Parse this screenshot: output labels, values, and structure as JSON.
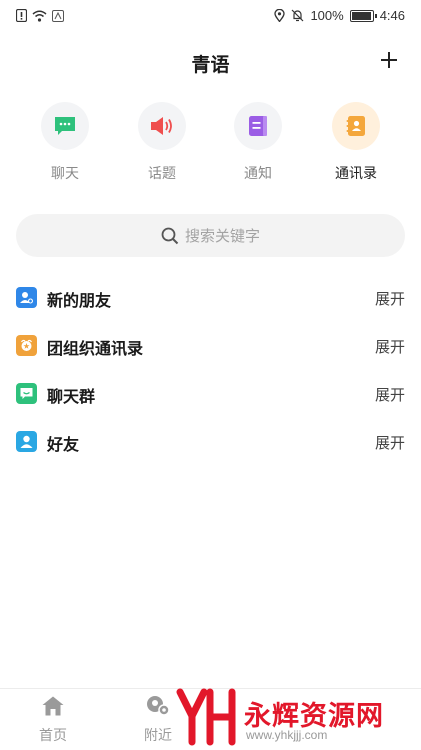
{
  "status_bar": {
    "battery": "100%",
    "battery_level": 1.0,
    "time": "4:46"
  },
  "header": {
    "title": "青语"
  },
  "quick_actions": [
    {
      "label": "聊天",
      "icon": "chat-bubble-icon",
      "color": "#2ec17c",
      "active": false
    },
    {
      "label": "话题",
      "icon": "speaker-icon",
      "color": "#ef4e4e",
      "active": false
    },
    {
      "label": "通知",
      "icon": "notice-icon",
      "color": "#9b5de5",
      "active": false
    },
    {
      "label": "通讯录",
      "icon": "contacts-book-icon",
      "color": "#f4a73c",
      "active": true
    }
  ],
  "search": {
    "placeholder": "搜索关键字"
  },
  "contact_groups": [
    {
      "label": "新的朋友",
      "action": "展开",
      "icon": "new-friend-icon",
      "color": "#2f87e8"
    },
    {
      "label": "团组织通讯录",
      "action": "展开",
      "icon": "organization-icon",
      "color": "#f0a23b"
    },
    {
      "label": "聊天群",
      "action": "展开",
      "icon": "group-chat-icon",
      "color": "#2ec17c"
    },
    {
      "label": "好友",
      "action": "展开",
      "icon": "friend-icon",
      "color": "#2aa7e3"
    }
  ],
  "tabbar": {
    "items": [
      {
        "label": "首页",
        "icon": "home-icon"
      },
      {
        "label": "附近",
        "icon": "nearby-icon"
      }
    ]
  },
  "watermark": {
    "text": "永辉资源网",
    "url": "www.yhkjjj.com",
    "brand_color": "#e2172a"
  }
}
